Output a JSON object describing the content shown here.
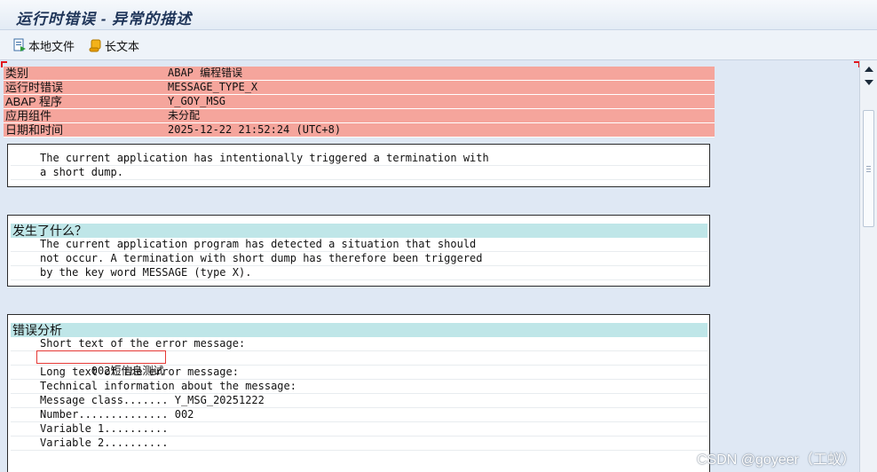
{
  "window": {
    "title": "运行时错误 - 异常的描述"
  },
  "toolbar": {
    "local_file_label": "本地文件",
    "long_text_label": "长文本"
  },
  "header_rows": [
    {
      "key": "类别",
      "value": "ABAP 编程错误"
    },
    {
      "key": "运行时错误",
      "value": "MESSAGE_TYPE_X"
    },
    {
      "key": "ABAP 程序",
      "value": "Y_GOY_MSG"
    },
    {
      "key": "应用组件",
      "value": "未分配"
    },
    {
      "key": "日期和时间",
      "value": "2025-12-22 21:52:24 (UTC+8)"
    }
  ],
  "summary": {
    "lines": [
      "The current application has intentionally triggered a termination with",
      "a short dump."
    ]
  },
  "what_happened": {
    "heading": "发生了什么？",
    "lines": [
      "The current application program has detected a situation that should",
      "not occur. A termination with short dump has therefore been triggered",
      "by the key word MESSAGE (type X)."
    ]
  },
  "error_analysis": {
    "heading": "错误分析",
    "lines": [
      "Short text of the error message:",
      "002短信息测试",
      "Long text of the error message:",
      "Technical information about the message:",
      "Message class....... Y_MSG_20251222",
      "Number.............. 002",
      "Variable 1..........",
      "Variable 2.........."
    ]
  },
  "watermark": {
    "text": "CSDN @goyeer（工蚁）"
  },
  "colors": {
    "header_bg": "#f5a59c",
    "section_head_bg": "#bfe6e8",
    "highlight": "#e53935"
  }
}
